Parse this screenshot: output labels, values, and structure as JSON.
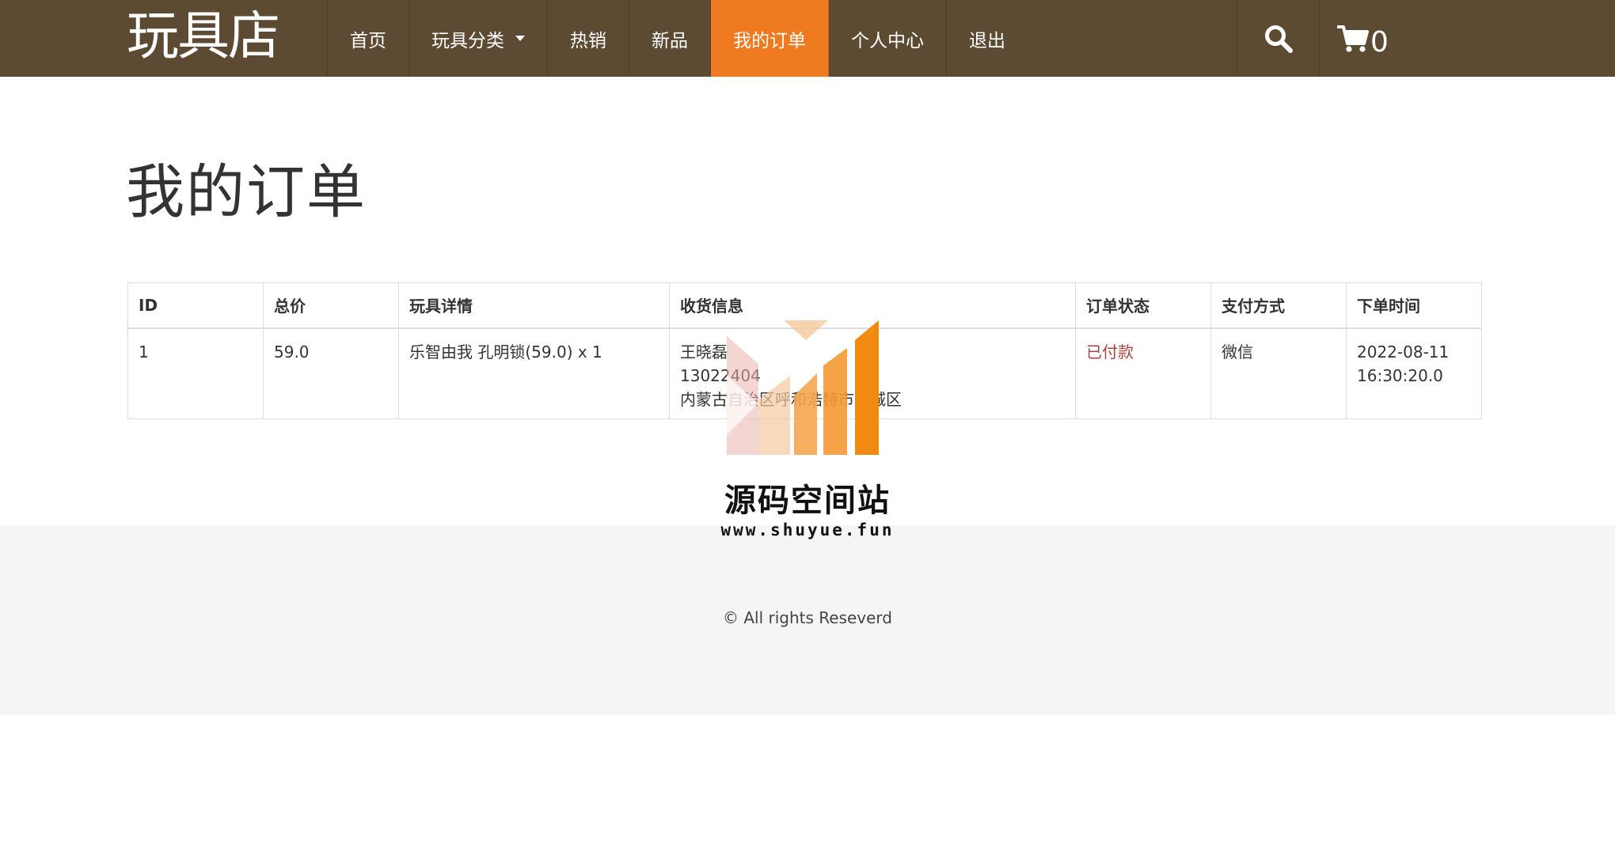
{
  "brand": {
    "name": "玩具店"
  },
  "nav": {
    "items": [
      {
        "label": "首页"
      },
      {
        "label": "玩具分类"
      },
      {
        "label": "热销"
      },
      {
        "label": "新品"
      },
      {
        "label": "我的订单",
        "active": true
      },
      {
        "label": "个人中心"
      },
      {
        "label": "退出"
      }
    ],
    "search_icon": "search-icon",
    "cart_icon": "cart-icon",
    "cart_count": "0"
  },
  "page": {
    "title": "我的订单"
  },
  "orders": {
    "columns": [
      "ID",
      "总价",
      "玩具详情",
      "收货信息",
      "订单状态",
      "支付方式",
      "下单时间"
    ],
    "rows": [
      {
        "id": "1",
        "total": "59.0",
        "detail": "乐智由我 孔明锁(59.0) x 1",
        "recipient_name": "王晓磊",
        "recipient_phone": "13022404",
        "recipient_address": "内蒙古自治区呼和浩特市新城区",
        "status": "已付款",
        "payment": "微信",
        "order_date": "2022-08-11",
        "order_time": "16:30:20.0"
      }
    ]
  },
  "footer": {
    "copyright": "© All rights Reseverd"
  },
  "watermark": {
    "title": "源码空间站",
    "url": "www.shuyue.fun"
  },
  "colors": {
    "navbar_bg": "#5d4a33",
    "nav_active_bg": "#f07a20",
    "status_paid": "#a94442",
    "footer_bg": "#f3f5f6"
  }
}
